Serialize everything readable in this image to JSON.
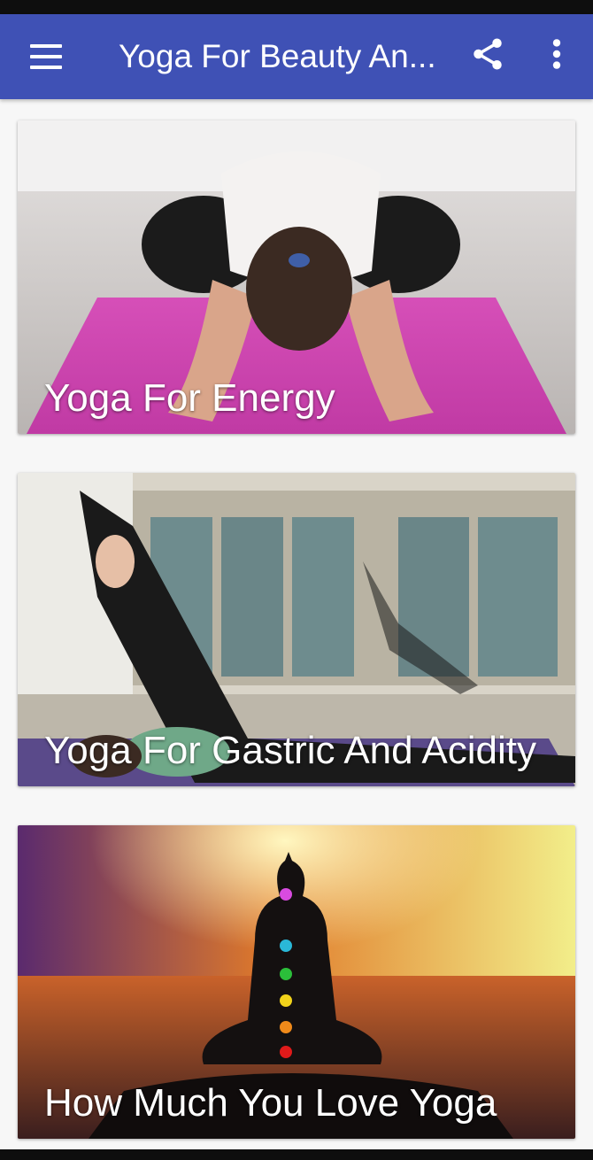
{
  "app_bar": {
    "title": "Yoga For Beauty An...",
    "background_color": "#3f51b5",
    "icons": {
      "menu": "hamburger-menu-icon",
      "share": "share-icon",
      "more": "more-vert-icon"
    }
  },
  "cards": [
    {
      "title": "Yoga For Energy",
      "image": "woman-childs-pose-on-pink-mat"
    },
    {
      "title": "Yoga For Gastric And Acidity",
      "image": "woman-leg-raise-in-studio"
    },
    {
      "title": "How Much You Love Yoga",
      "image": "meditating-silhouette-with-chakras-at-sunset"
    }
  ]
}
